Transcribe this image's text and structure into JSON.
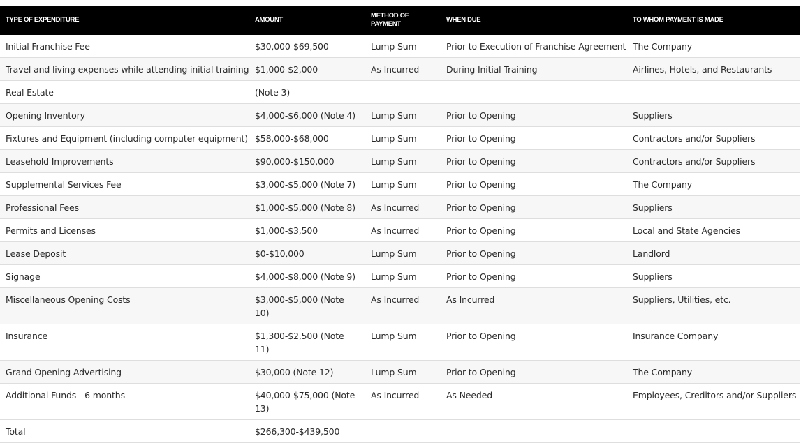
{
  "table": {
    "headers": [
      "Type of Expenditure",
      "Amount",
      "Method of Payment",
      "When Due",
      "To Whom Payment Is Made"
    ],
    "rows": [
      [
        "Initial Franchise Fee",
        "$30,000-$69,500",
        "Lump Sum",
        "Prior to Execution of Franchise Agreement",
        "The Company"
      ],
      [
        "Travel and living expenses while attending initial training",
        "$1,000-$2,000",
        "As Incurred",
        "During Initial Training",
        "Airlines, Hotels, and Restaurants"
      ],
      [
        "Real Estate",
        "(Note 3)",
        "",
        "",
        ""
      ],
      [
        "Opening Inventory",
        "$4,000-$6,000 (Note 4)",
        "Lump Sum",
        "Prior to Opening",
        "Suppliers"
      ],
      [
        "Fixtures and Equipment (including computer equipment)",
        "$58,000-$68,000",
        "Lump Sum",
        "Prior to Opening",
        "Contractors and/or Suppliers"
      ],
      [
        "Leasehold Improvements",
        "$90,000-$150,000",
        "Lump Sum",
        "Prior to Opening",
        "Contractors and/or Suppliers"
      ],
      [
        "Supplemental Services Fee",
        "$3,000-$5,000 (Note 7)",
        "Lump Sum",
        "Prior to Opening",
        "The Company"
      ],
      [
        "Professional Fees",
        "$1,000-$5,000 (Note 8)",
        "As Incurred",
        "Prior to Opening",
        "Suppliers"
      ],
      [
        "Permits and Licenses",
        "$1,000-$3,500",
        "As Incurred",
        "Prior to Opening",
        "Local and State Agencies"
      ],
      [
        "Lease Deposit",
        "$0-$10,000",
        "Lump Sum",
        "Prior to Opening",
        "Landlord"
      ],
      [
        "Signage",
        "$4,000-$8,000 (Note 9)",
        "Lump Sum",
        "Prior to Opening",
        "Suppliers"
      ],
      [
        "Miscellaneous Opening Costs",
        "$3,000-$5,000 (Note 10)",
        "As Incurred",
        "As Incurred",
        "Suppliers, Utilities, etc."
      ],
      [
        "Insurance",
        "$1,300-$2,500 (Note 11)",
        "Lump Sum",
        "Prior to Opening",
        "Insurance Company"
      ],
      [
        "Grand Opening Advertising",
        "$30,000 (Note 12)",
        "Lump Sum",
        "Prior to Opening",
        "The Company"
      ],
      [
        "Additional Funds - 6 months",
        "$40,000-$75,000 (Note 13)",
        "As Incurred",
        "As Needed",
        "Employees, Creditors and/or Suppliers"
      ],
      [
        "Total",
        "$266,300-$439,500",
        "",
        "",
        ""
      ]
    ]
  }
}
